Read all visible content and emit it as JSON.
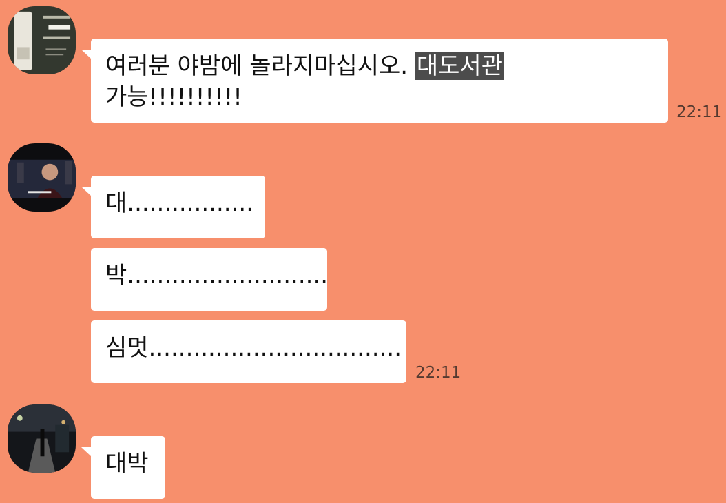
{
  "messages": [
    {
      "line1": "여러분 야밤에 놀라지마십시오.",
      "highlight": "대도서관",
      "line2": "가능!!!!!!!!!!",
      "time": "22:11"
    },
    {
      "bubbles": [
        "대.................",
        "박...........................",
        "심멋.................................."
      ],
      "time": "22:11"
    },
    {
      "bubbles": [
        "대박"
      ]
    }
  ]
}
